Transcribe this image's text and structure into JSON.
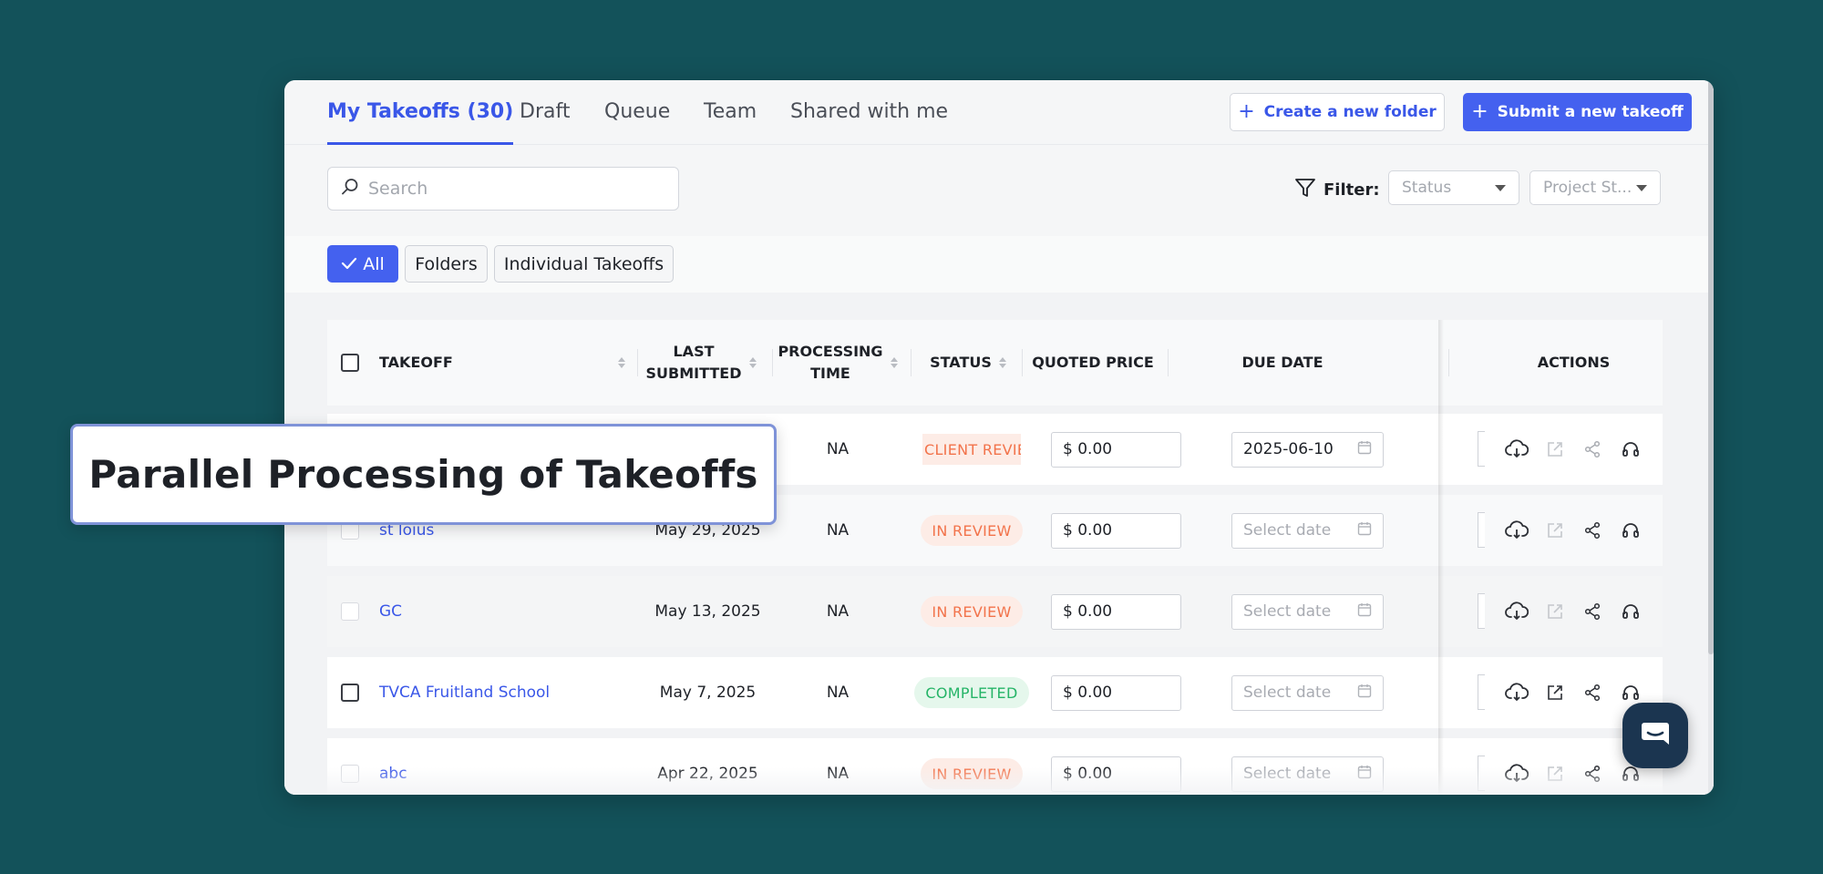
{
  "tabs": [
    {
      "label": "My Takeoffs (30)",
      "active": true
    },
    {
      "label": "Draft"
    },
    {
      "label": "Queue"
    },
    {
      "label": "Team"
    },
    {
      "label": "Shared with me"
    }
  ],
  "header_buttons": {
    "create_folder": "Create a new folder",
    "submit_takeoff": "Submit a new takeoff"
  },
  "search": {
    "placeholder": "Search"
  },
  "filter": {
    "label": "Filter:",
    "status_placeholder": "Status",
    "project_placeholder": "Project St..."
  },
  "chips": [
    {
      "label": "All",
      "active": true
    },
    {
      "label": "Folders"
    },
    {
      "label": "Individual Takeoffs"
    }
  ],
  "columns": {
    "takeoff": "TAKEOFF",
    "last_submitted_1": "LAST",
    "last_submitted_2": "SUBMITTED",
    "processing_1": "PROCESSING",
    "processing_2": "TIME",
    "status": "STATUS",
    "quoted_price": "QUOTED PRICE",
    "due_date": "DUE DATE",
    "actions": "ACTIONS"
  },
  "rows": [
    {
      "name": "",
      "submitted": "",
      "processing": "NA",
      "status": "CLIENT REVIEW",
      "status_kind": "client",
      "price": "$ 0.00",
      "due": "2025-06-10"
    },
    {
      "name": "st loius",
      "submitted": "May 29, 2025",
      "processing": "NA",
      "status": "IN REVIEW",
      "status_kind": "review",
      "price": "$ 0.00",
      "due": "Select date"
    },
    {
      "name": "GC",
      "submitted": "May 13, 2025",
      "processing": "NA",
      "status": "IN REVIEW",
      "status_kind": "review",
      "price": "$ 0.00",
      "due": "Select date"
    },
    {
      "name": "TVCA Fruitland School",
      "submitted": "May 7, 2025",
      "processing": "NA",
      "status": "COMPLETED",
      "status_kind": "done",
      "price": "$ 0.00",
      "due": "Select date"
    },
    {
      "name": "abc",
      "submitted": "Apr 22, 2025",
      "processing": "NA",
      "status": "IN REVIEW",
      "status_kind": "review",
      "price": "$ 0.00",
      "due": "Select date"
    }
  ],
  "callout": {
    "text": "Parallel Processing of Takeoffs"
  },
  "colors": {
    "accent": "#4461ef",
    "background": "#13525a",
    "review": "#f2734b",
    "completed": "#25b467"
  }
}
